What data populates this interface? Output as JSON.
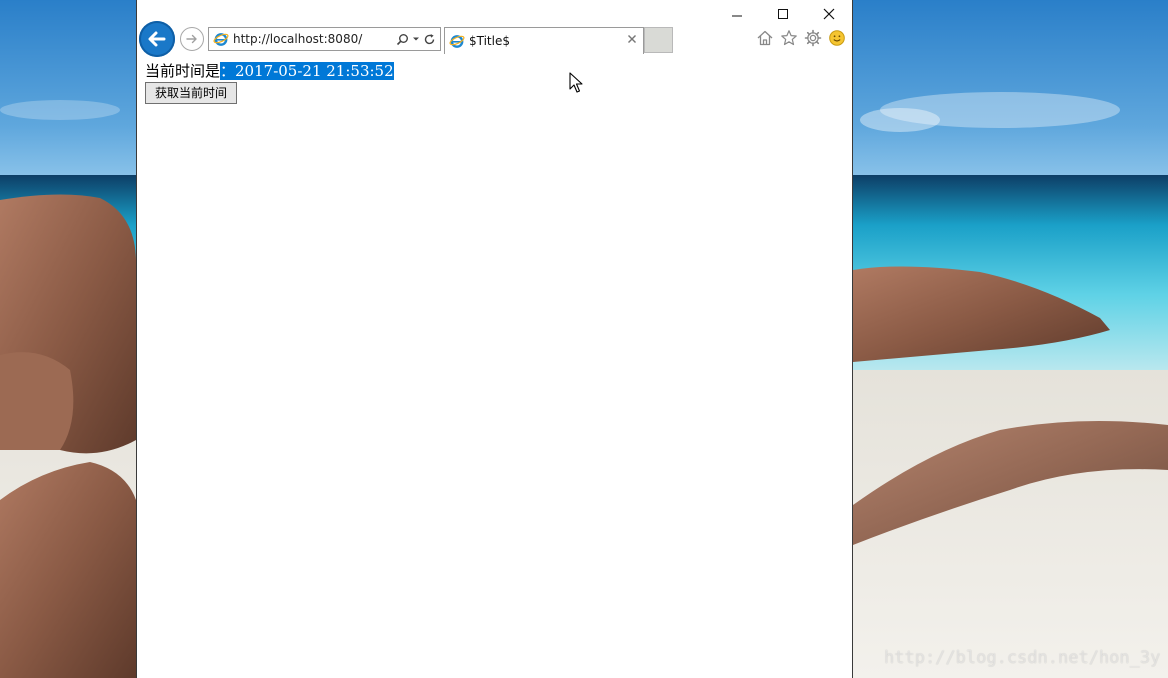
{
  "browser": {
    "url": "http://localhost:8080/",
    "tab": {
      "title": "$Title$"
    },
    "window_controls": {
      "minimize": "minimize-icon",
      "maximize": "maximize-icon",
      "close": "close-icon"
    },
    "icons": [
      "back-arrow-icon",
      "forward-arrow-icon",
      "ie-logo-icon",
      "search-icon",
      "dropdown-icon",
      "refresh-icon",
      "tab-close-icon",
      "home-icon",
      "favorites-star-icon",
      "settings-gear-icon",
      "smiley-feedback-icon"
    ]
  },
  "page": {
    "time_label": "当前时间是",
    "time_value": "：2017-05-21 21:53:52",
    "fetch_button": "获取当前时间"
  },
  "desktop": {
    "watermark": "http://blog.csdn.net/hon_3y"
  },
  "colors": {
    "accent": "#1a78c8",
    "selection": "#0078d7"
  }
}
